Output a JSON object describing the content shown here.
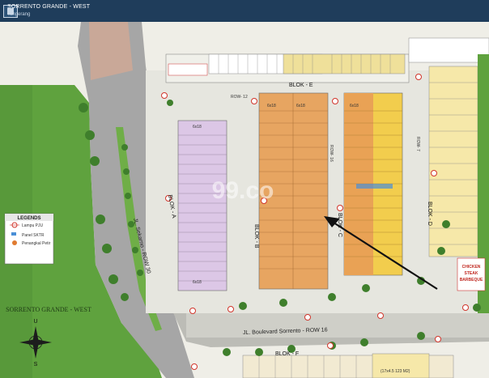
{
  "header": {
    "title": "SORRENTO GRANDE - WEST",
    "subtitle": "Tangerang"
  },
  "map": {
    "blocks": [
      "BLOK - A",
      "BLOK - B",
      "BLOK - C",
      "BLOK - D",
      "BLOK - E",
      "BLOK - F"
    ],
    "roads": {
      "sekarno": "JL. Sekarno - ROW 30",
      "boulevard": "JL. Boulevard Sorrento - ROW 16",
      "row16": "ROW- 16",
      "row12": "ROW- 12",
      "row7": "ROW- 7"
    },
    "site_label": "SORRENTO GRANDE - WEST",
    "shop_label": [
      "CHICKEN",
      "STEAK",
      "BARBEQUE"
    ],
    "lot_sizes": [
      "6x18",
      "6x18",
      "6x18",
      "6x18",
      "6x18"
    ],
    "lot_note": "(17x4.5 123 M2)",
    "watermark": "99.co",
    "legend": {
      "title": "LEGENDS",
      "items": [
        "Lampu PJU",
        "Panel SKTR",
        "Penangkal Petir"
      ]
    },
    "compass": {
      "north": "U",
      "south": "S"
    },
    "colors": {
      "grass": "#5fa23e",
      "road": "#a6a6a6",
      "paving": "#e6e6df",
      "block_a": "#dcc7e6",
      "block_b": "#e7a561",
      "block_c": "#f2cd4d",
      "block_d": "#f6e8a9",
      "block_e": "#efe09a",
      "block_f": "#f2ead2",
      "accent": "#d1352b",
      "titlebar": "#1f3d5b"
    }
  }
}
